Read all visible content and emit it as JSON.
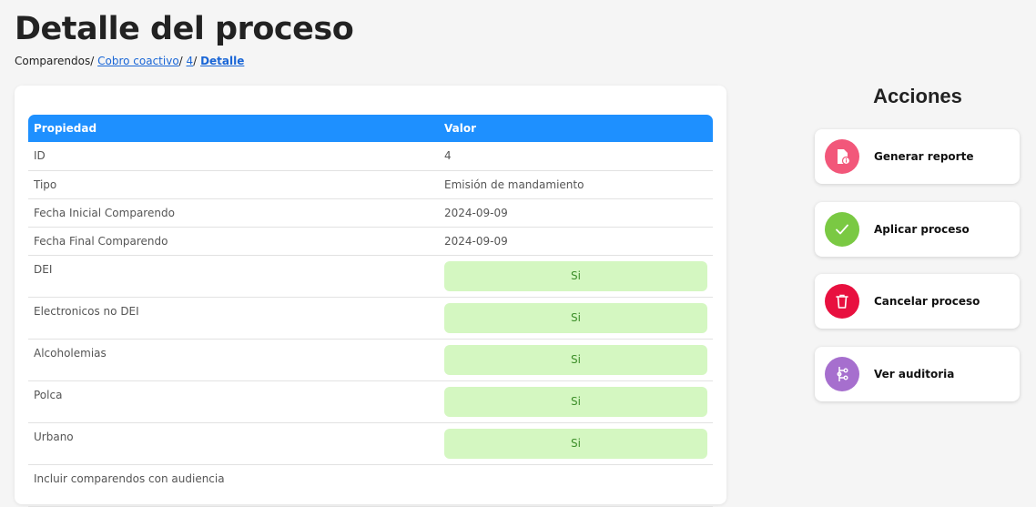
{
  "page_title": "Detalle del proceso",
  "breadcrumb": {
    "root": "Comparendos/",
    "link1": "Cobro coactivo",
    "sep1": "/",
    "link2": "4",
    "sep2": "/",
    "current": "Detalle"
  },
  "table": {
    "headers": [
      "Propiedad",
      "Valor"
    ],
    "rows": [
      {
        "prop": "ID",
        "value": "4"
      },
      {
        "prop": "Tipo",
        "value": "Emisión de mandamiento"
      },
      {
        "prop": "Fecha Inicial Comparendo",
        "value": "2024-09-09"
      },
      {
        "prop": "Fecha Final Comparendo",
        "value": "2024-09-09"
      },
      {
        "prop": "DEI",
        "value": "Si"
      },
      {
        "prop": "Electronicos no DEI",
        "value": "Si"
      },
      {
        "prop": "Alcoholemias",
        "value": "Si"
      },
      {
        "prop": "Polca",
        "value": "Si"
      },
      {
        "prop": "Urbano",
        "value": "Si"
      },
      {
        "prop": "Incluir comparendos con audiencia",
        "value": ""
      }
    ]
  },
  "actions": {
    "title": "Acciones",
    "items": [
      {
        "label": "Generar reporte",
        "icon": "report-icon",
        "color": "#f2577a"
      },
      {
        "label": "Aplicar proceso",
        "icon": "check-icon",
        "color": "#7ac943"
      },
      {
        "label": "Cancelar proceso",
        "icon": "trash-icon",
        "color": "#e8103f"
      },
      {
        "label": "Ver auditoria",
        "icon": "audit-icon",
        "color": "#a66fce"
      }
    ]
  },
  "colors": {
    "header_bg": "#1e90ff",
    "badge_bg": "#d4f7c1",
    "badge_text": "#3d8f2a",
    "link": "#1a66d6"
  }
}
